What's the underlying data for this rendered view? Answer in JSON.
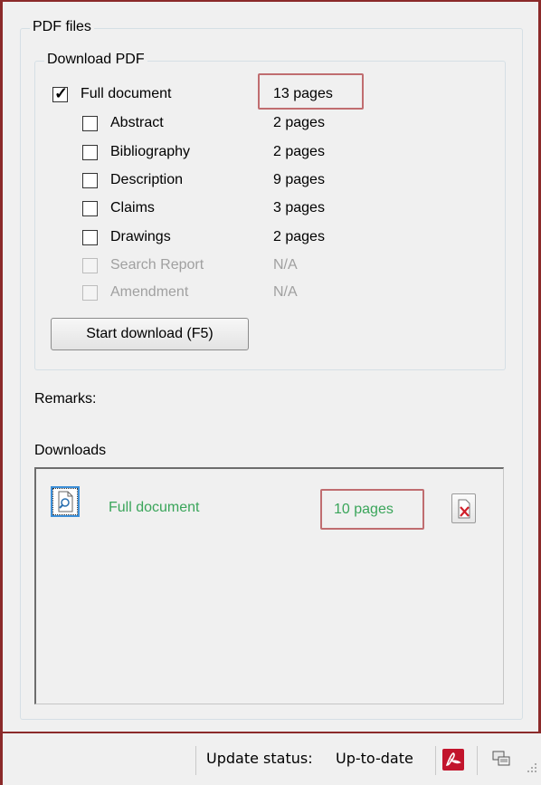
{
  "pdf_files": {
    "legend": "PDF files",
    "download_pdf": {
      "legend": "Download PDF",
      "items": [
        {
          "label": "Full document",
          "pages": "13 pages",
          "checked": true,
          "enabled": true
        },
        {
          "label": "Abstract",
          "pages": "2 pages",
          "checked": false,
          "enabled": true
        },
        {
          "label": "Bibliography",
          "pages": "2 pages",
          "checked": false,
          "enabled": true
        },
        {
          "label": "Description",
          "pages": "9 pages",
          "checked": false,
          "enabled": true
        },
        {
          "label": "Claims",
          "pages": "3 pages",
          "checked": false,
          "enabled": true
        },
        {
          "label": "Drawings",
          "pages": "2 pages",
          "checked": false,
          "enabled": true
        },
        {
          "label": "Search Report",
          "pages": "N/A",
          "checked": false,
          "enabled": false
        },
        {
          "label": "Amendment",
          "pages": "N/A",
          "checked": false,
          "enabled": false
        }
      ],
      "start_button": "Start download (F5)"
    },
    "remarks_label": "Remarks:",
    "downloads": {
      "label": "Downloads",
      "items": [
        {
          "name": "Full document",
          "pages": "10 pages"
        }
      ]
    }
  },
  "statusbar": {
    "update_label": "Update status:",
    "update_value": "Up-to-date"
  },
  "colors": {
    "frame": "#8b2a2a",
    "highlight": "#c06d70",
    "download_text": "#3aa55a"
  }
}
